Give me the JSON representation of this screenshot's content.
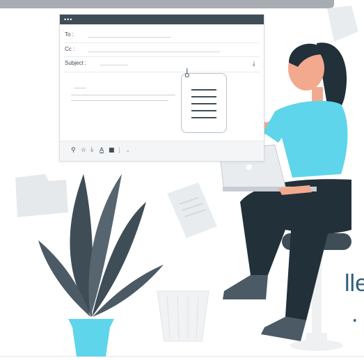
{
  "email": {
    "to_label": "To :",
    "cc_label": "Cc :",
    "subject_label": "Subject :",
    "window_dots": "•••"
  },
  "toolbar": {
    "icons": [
      "location-icon",
      "star-icon",
      "attachment-icon",
      "text-format-icon",
      "delete-icon",
      "more-icon"
    ],
    "symbols": [
      "⚲",
      "☆",
      "⫰",
      "A",
      "■",
      "⌄"
    ]
  },
  "page_text": {
    "line1": "lle",
    "line2": "."
  },
  "colors": {
    "accent_cyan": "#5ed5ea",
    "dark_slate": "#3f4d57",
    "title_blue": "#2f5f7d",
    "light_gray": "#e9ecef"
  }
}
